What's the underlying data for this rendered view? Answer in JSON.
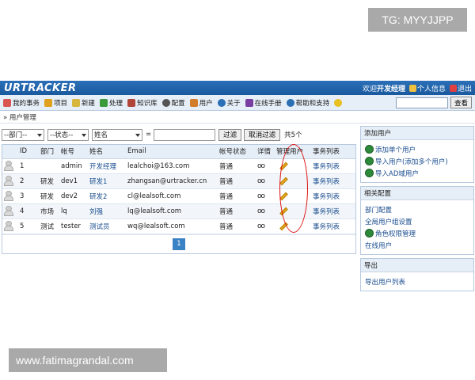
{
  "watermarks": {
    "top": "TG: MYYJJPP",
    "bottom": "www.fatimagrandal.com"
  },
  "header": {
    "logo": "URTRACKER",
    "welcome": "欢迎",
    "user": "开发经理",
    "profile": "个人信息",
    "logout": "退出"
  },
  "nav": {
    "items": [
      {
        "label": "我的事务",
        "icon": "home-icon",
        "color": "#d9534f"
      },
      {
        "label": "项目",
        "icon": "project-icon",
        "color": "#e0a21c"
      },
      {
        "label": "新建",
        "icon": "new-icon",
        "color": "#d6b73b"
      },
      {
        "label": "处理",
        "icon": "check-icon",
        "color": "#3a9a3a"
      },
      {
        "label": "知识库",
        "icon": "book-icon",
        "color": "#b0463a"
      },
      {
        "label": "配置",
        "icon": "gear-icon",
        "color": "#555555"
      },
      {
        "label": "用户",
        "icon": "users-icon",
        "color": "#d17d2a"
      },
      {
        "label": "关于",
        "icon": "info-icon",
        "color": "#2b6fb5"
      },
      {
        "label": "在线手册",
        "icon": "manual-icon",
        "color": "#7a3ea0"
      },
      {
        "label": "帮助和支持",
        "icon": "help-icon",
        "color": "#2b6fb5"
      }
    ],
    "search_button": "查看"
  },
  "breadcrumb": "» 用户管理",
  "filters": {
    "department": "--部门--",
    "status": "--状态--",
    "field": "姓名",
    "operator": "=",
    "filter_button": "过滤",
    "cancel_button": "取消过滤",
    "count": "共5个"
  },
  "table": {
    "columns": [
      "",
      "ID",
      "部门",
      "帐号",
      "姓名",
      "Email",
      "帐号状态",
      "详情",
      "管理用户",
      "事务列表"
    ],
    "rows": [
      {
        "id": "1",
        "dept": "",
        "account": "admin",
        "name": "开发经理",
        "email": "lealchoi@163.com",
        "status": "普通",
        "tasks": "事务列表"
      },
      {
        "id": "2",
        "dept": "研发",
        "account": "dev1",
        "name": "研发1",
        "email": "zhangsan@urtracker.cn",
        "status": "普通",
        "tasks": "事务列表"
      },
      {
        "id": "3",
        "dept": "研发",
        "account": "dev2",
        "name": "研发2",
        "email": "cl@lealsoft.com",
        "status": "普通",
        "tasks": "事务列表"
      },
      {
        "id": "4",
        "dept": "市场",
        "account": "lq",
        "name": "刘强",
        "email": "lq@lealsoft.com",
        "status": "普通",
        "tasks": "事务列表"
      },
      {
        "id": "5",
        "dept": "测试",
        "account": "tester",
        "name": "测试员",
        "email": "wq@lealsoft.com",
        "status": "普通",
        "tasks": "事务列表"
      }
    ],
    "page": "1"
  },
  "sidebar": {
    "add_user": {
      "title": "添加用户",
      "items": [
        "添加单个用户",
        "导入用户(添加多个用户)",
        "导入AD域用户"
      ]
    },
    "related": {
      "title": "相关配置",
      "items": [
        "部门配置",
        "全局用户组设置",
        "角色权限管理",
        "在线用户"
      ]
    },
    "export": {
      "title": "导出",
      "items": [
        "导出用户列表"
      ]
    }
  },
  "colors": {
    "header": "#1f62a8",
    "accent": "#3b82c4",
    "annotation": "#dd1111"
  }
}
